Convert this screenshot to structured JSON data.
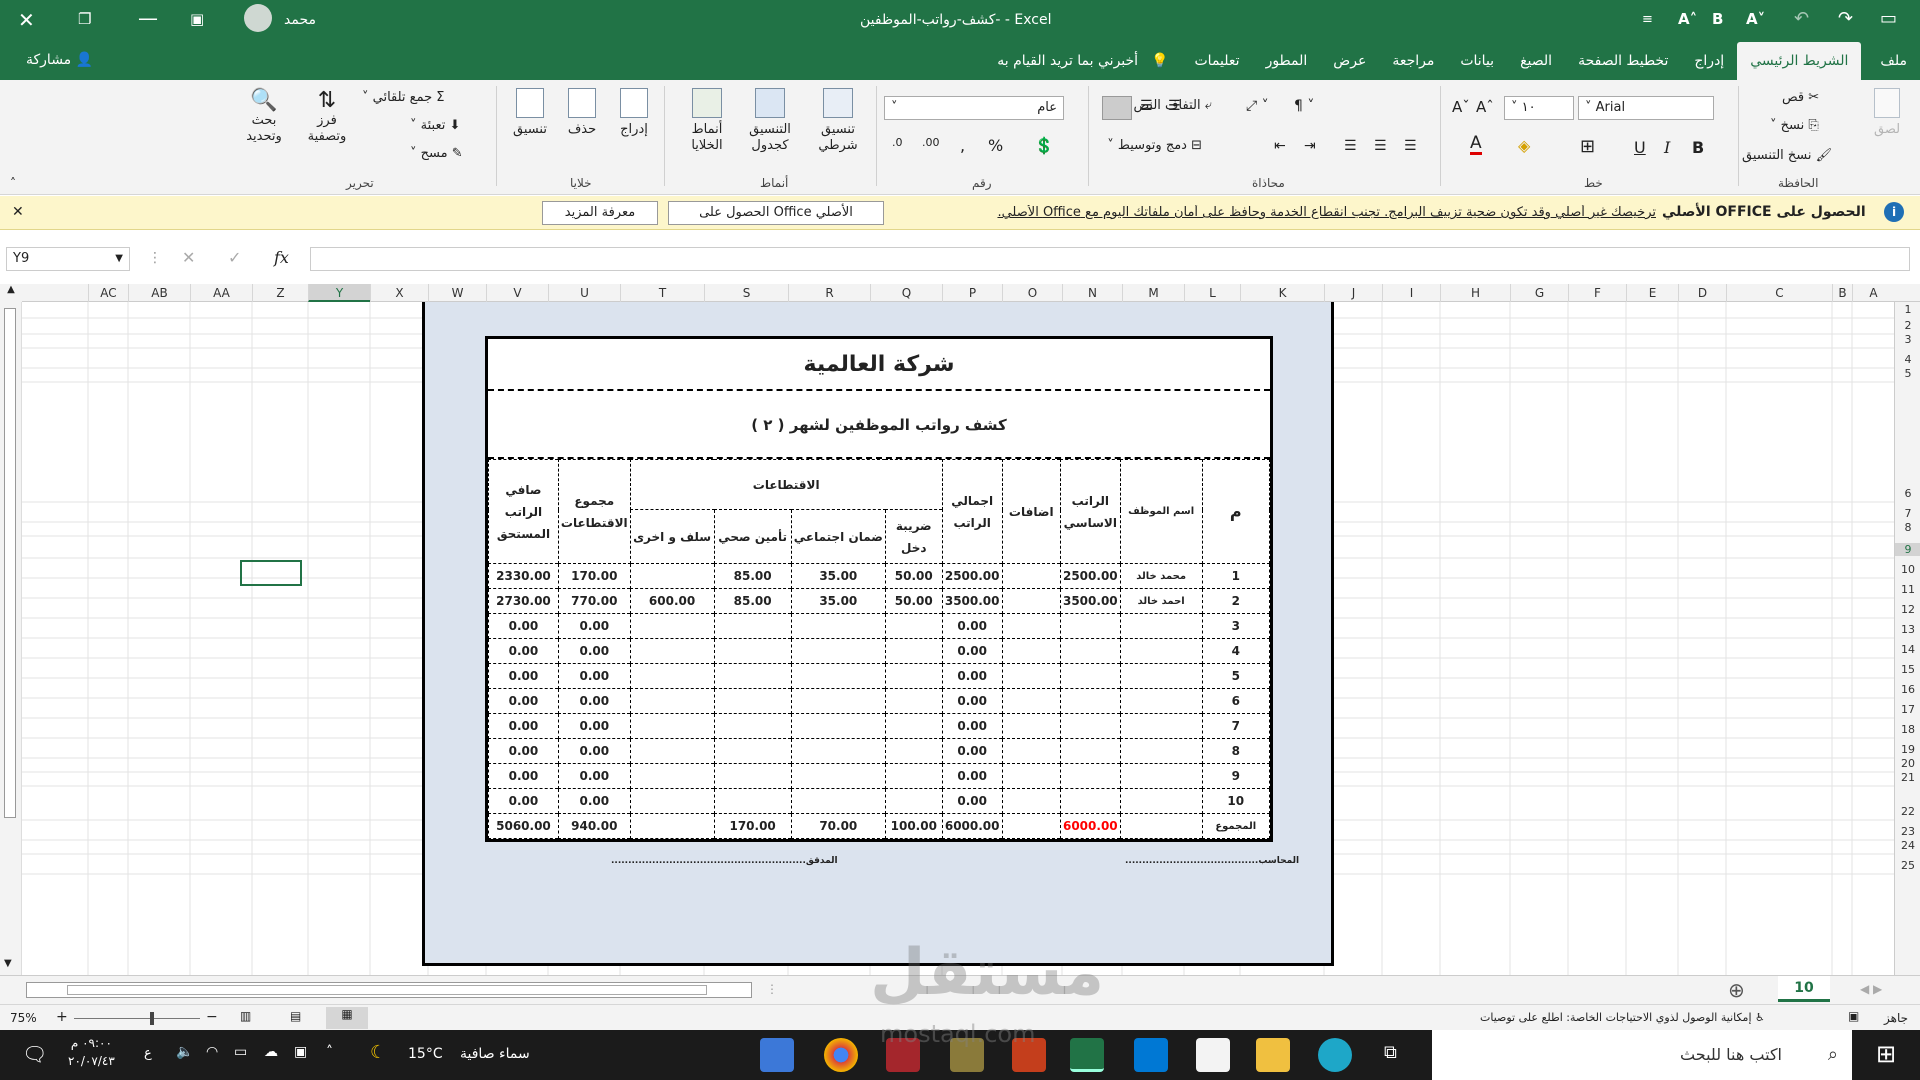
{
  "titlebar": {
    "title": "كشف-رواتب-الموظفين-  -  Excel",
    "user": "محمد"
  },
  "tabs": [
    {
      "label": "ملف",
      "active": false
    },
    {
      "label": "الشريط الرئيسي",
      "active": true
    },
    {
      "label": "إدراج",
      "active": false
    },
    {
      "label": "تخطيط الصفحة",
      "active": false
    },
    {
      "label": "الصيغ",
      "active": false
    },
    {
      "label": "بيانات",
      "active": false
    },
    {
      "label": "مراجعة",
      "active": false
    },
    {
      "label": "عرض",
      "active": false
    },
    {
      "label": "المطور",
      "active": false
    },
    {
      "label": "تعليمات",
      "active": false
    },
    {
      "label": "أخبرني بما تريد القيام به",
      "active": false
    }
  ],
  "share_label": "مشاركة",
  "ribbon": {
    "clipboard": {
      "label": "الحافظة",
      "paste": "لصق",
      "cut": "قص",
      "copy": "نسخ",
      "format_painter": "نسخ التنسيق"
    },
    "font": {
      "label": "خط",
      "name": "Arial",
      "size": "١٠",
      "bold": "B",
      "italic": "I",
      "underline": "U"
    },
    "alignment": {
      "label": "محاذاة",
      "wrap": "التفاف النص",
      "merge": "دمج وتوسيط"
    },
    "number": {
      "label": "رقم",
      "format": "عام"
    },
    "styles": {
      "label": "أنماط",
      "conditional": "تنسيق شرطي",
      "table": "التنسيق كجدول",
      "cell_styles": "أنماط الخلايا"
    },
    "cells": {
      "label": "خلايا",
      "insert": "إدراج",
      "delete": "حذف",
      "format": "تنسيق"
    },
    "editing": {
      "label": "تحرير",
      "autosum": "جمع تلقائي",
      "fill": "تعبئة",
      "clear": "مسح",
      "sort": "فرز وتصفية",
      "find": "بحث وتحديد"
    }
  },
  "message_bar": {
    "title": "الحصول على OFFICE الأصلي",
    "text": "ترخيصك غير أصلي وقد تكون ضحية تزييف البرامج. تجنب انقطاع الخدمة وحافظ على أمان ملفاتك اليوم مع Office الأصلي.",
    "button1": "الحصول على Office الأصلي",
    "button2": "معرفة المزيد"
  },
  "formula_bar": {
    "name_box": "Y9",
    "fx": "fx"
  },
  "columns": [
    "A",
    "B",
    "C",
    "D",
    "E",
    "F",
    "G",
    "H",
    "I",
    "J",
    "K",
    "L",
    "M",
    "N",
    "O",
    "P",
    "Q",
    "R",
    "S",
    "T",
    "U",
    "V",
    "W",
    "X",
    "Y",
    "Z",
    "AA",
    "AB",
    "AC"
  ],
  "rows": [
    "1",
    "2",
    "3",
    "4",
    "5",
    "6",
    "7",
    "8",
    "9",
    "10",
    "11",
    "12",
    "13",
    "14",
    "15",
    "16",
    "17",
    "18",
    "19",
    "20",
    "21",
    "22",
    "23",
    "24",
    "25"
  ],
  "sheet": {
    "company": "شركة العالمية",
    "subtitle": "كشف رواتب الموظفين  لشهر (  ٢  )",
    "headers": {
      "no": "م",
      "name": "اسم الموظف",
      "basic": "الراتب الاساسي",
      "additions": "اضافات",
      "total": "اجمالي الراتب",
      "deductions": "الاقتطاعات",
      "tax": "ضريبة دخل",
      "social": "ضمان اجتماعي",
      "health": "تأمين صحي",
      "loans": "سلف و اخرى",
      "total_deductions": "مجموع الاقتطاعات",
      "net": "صافي الراتب المستحق"
    },
    "rows": [
      {
        "no": "1",
        "name": "محمد خالد",
        "basic": "2500.00",
        "add": "",
        "total": "2500.00",
        "tax": "50.00",
        "social": "35.00",
        "health": "85.00",
        "loans": "",
        "tded": "170.00",
        "net": "2330.00"
      },
      {
        "no": "2",
        "name": "احمد خالد",
        "basic": "3500.00",
        "add": "",
        "total": "3500.00",
        "tax": "50.00",
        "social": "35.00",
        "health": "85.00",
        "loans": "600.00",
        "tded": "770.00",
        "net": "2730.00"
      },
      {
        "no": "3",
        "name": "",
        "basic": "",
        "add": "",
        "total": "0.00",
        "tax": "",
        "social": "",
        "health": "",
        "loans": "",
        "tded": "0.00",
        "net": "0.00"
      },
      {
        "no": "4",
        "name": "",
        "basic": "",
        "add": "",
        "total": "0.00",
        "tax": "",
        "social": "",
        "health": "",
        "loans": "",
        "tded": "0.00",
        "net": "0.00"
      },
      {
        "no": "5",
        "name": "",
        "basic": "",
        "add": "",
        "total": "0.00",
        "tax": "",
        "social": "",
        "health": "",
        "loans": "",
        "tded": "0.00",
        "net": "0.00"
      },
      {
        "no": "6",
        "name": "",
        "basic": "",
        "add": "",
        "total": "0.00",
        "tax": "",
        "social": "",
        "health": "",
        "loans": "",
        "tded": "0.00",
        "net": "0.00"
      },
      {
        "no": "7",
        "name": "",
        "basic": "",
        "add": "",
        "total": "0.00",
        "tax": "",
        "social": "",
        "health": "",
        "loans": "",
        "tded": "0.00",
        "net": "0.00"
      },
      {
        "no": "8",
        "name": "",
        "basic": "",
        "add": "",
        "total": "0.00",
        "tax": "",
        "social": "",
        "health": "",
        "loans": "",
        "tded": "0.00",
        "net": "0.00"
      },
      {
        "no": "9",
        "name": "",
        "basic": "",
        "add": "",
        "total": "0.00",
        "tax": "",
        "social": "",
        "health": "",
        "loans": "",
        "tded": "0.00",
        "net": "0.00"
      },
      {
        "no": "10",
        "name": "",
        "basic": "",
        "add": "",
        "total": "0.00",
        "tax": "",
        "social": "",
        "health": "",
        "loans": "",
        "tded": "0.00",
        "net": "0.00"
      }
    ],
    "totals": {
      "label": "المجموع",
      "basic": "6000.00",
      "add": "",
      "total": "6000.00",
      "tax": "100.00",
      "social": "70.00",
      "health": "170.00",
      "loans": "",
      "tded": "940.00",
      "net": "5060.00"
    },
    "accountant": "المحاسب.......................................",
    "auditor": "المدقق.........................................................",
    "highlight_color": "#ff0000"
  },
  "sheet_tab": "10",
  "status": {
    "ready": "جاهز",
    "accessibility": "إمكانية الوصول لذوي الاحتياجات الخاصة: اطلع على توصيات",
    "zoom": "75%"
  },
  "taskbar": {
    "search": "اكتب هنا للبحث",
    "weather": "سماء صافية",
    "temp": "15°C",
    "time": "٠٩:٠٠ م",
    "date": "٢٠/٠٧/٤٣",
    "lang": "ع"
  },
  "watermark": {
    "text": "مستقل",
    "url": "mostaql.com"
  }
}
